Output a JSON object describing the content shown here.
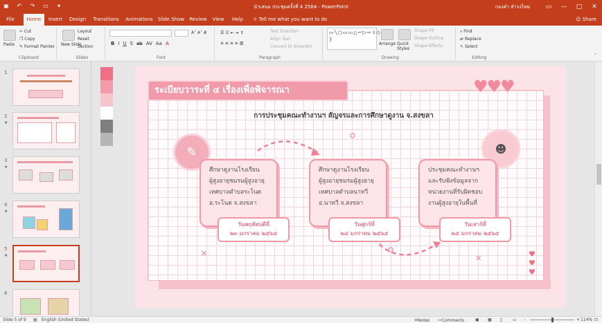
{
  "titlebar": {
    "doc_title": "นำเสนอ ประชุมครั้งที่ 4 2564 - PowerPoint",
    "user_name": "กองคำ ธำรงไทย",
    "qat_icons": [
      "save-icon",
      "undo-icon",
      "redo-icon",
      "start-slideshow-icon",
      "customize-icon"
    ],
    "window_controls": [
      "minimize-icon",
      "maximize-icon",
      "close-icon"
    ]
  },
  "tabs": {
    "items": [
      "File",
      "Home",
      "Insert",
      "Design",
      "Transitions",
      "Animations",
      "Slide Show",
      "Review",
      "View",
      "Help"
    ],
    "active": "Home",
    "tell_me": "Tell me what you want to do",
    "share": "Share"
  },
  "ribbon": {
    "clipboard": {
      "paste": "Paste",
      "cut": "Cut",
      "copy": "Copy",
      "format_painter": "Format Painter",
      "label": "Clipboard"
    },
    "slides": {
      "new_slide": "New Slide",
      "layout": "Layout",
      "reset": "Reset",
      "section": "Section",
      "label": "Slides"
    },
    "font": {
      "label": "Font",
      "buttons": [
        "B",
        "I",
        "U",
        "S",
        "ab",
        "AV",
        "Aa",
        "A"
      ]
    },
    "paragraph": {
      "text_direction": "Text Direction",
      "align_text": "Align Text",
      "smartart": "Convert to SmartArt",
      "label": "Paragraph"
    },
    "drawing": {
      "shapes_glyphs": "▭╲○▭▭△⌐▷⇨⇩◇☆{ }",
      "arrange": "Arrange",
      "quick_styles": "Quick Styles",
      "shape_fill": "Shape Fill",
      "shape_outline": "Shape Outline",
      "shape_effects": "Shape Effects",
      "label": "Drawing"
    },
    "editing": {
      "find": "Find",
      "replace": "Replace",
      "select": "Select",
      "label": "Editing"
    }
  },
  "thumbnails": [
    {
      "num": "1",
      "star": ""
    },
    {
      "num": "2",
      "star": "★"
    },
    {
      "num": "3",
      "star": "★"
    },
    {
      "num": "4",
      "star": "★"
    },
    {
      "num": "5",
      "star": "★",
      "selected": true
    },
    {
      "num": "6",
      "star": ""
    }
  ],
  "slide": {
    "title": "ระเบียบวาระที่ ๔ เรื่องเพื่อพิจารณา",
    "subtitle": "การประชุมคณะทำงานฯ สัญจรและการศึกษาดูงาน จ.สงขลา",
    "cards": [
      {
        "lines": [
          "ศึกษาดูงานโรงเรียน",
          "ผู้สูงอายุชมรมผู้สูงอายุ",
          "เทศบาลตำบลระโนด",
          "อ.ระโนด จ.สงขลา"
        ],
        "day": "วันพฤหัสบดีที่",
        "date": "๒๓ มกราคม ๒๕๖๕"
      },
      {
        "lines": [
          "ศึกษาดูงานโรงเรียน",
          "ผู้สูงอายุชมรมผู้สูงอายุ",
          "เทศบาลตำบลนาทวี",
          "อ.นาทวี จ.สงขลา"
        ],
        "day": "วันศุกร์ที่",
        "date": "๒๔ มกราคม ๒๕๖๕"
      },
      {
        "lines": [
          "ประชุมคณะทำงานฯ",
          "และรับฟังข้อมูลจาก",
          "หน่วยงานที่รับผิดชอบ",
          "งานผู้สูงอายุในพื้นที่"
        ],
        "day": "วันเสาร์ที่",
        "date": "๒๕ มกราคม ๒๕๖๕"
      }
    ],
    "hearts": "♥♥♥",
    "accent": "#f19aa9",
    "swatches": [
      "#ee6f86",
      "#f29cab",
      "#f7c4cd",
      "#ffffff",
      "#7f7f7f",
      "#b5b5b5"
    ]
  },
  "statusbar": {
    "slide_info": "Slide 5 of 9",
    "language": "English (United States)",
    "notes": "Notes",
    "comments": "Comments",
    "zoom": "114%"
  }
}
